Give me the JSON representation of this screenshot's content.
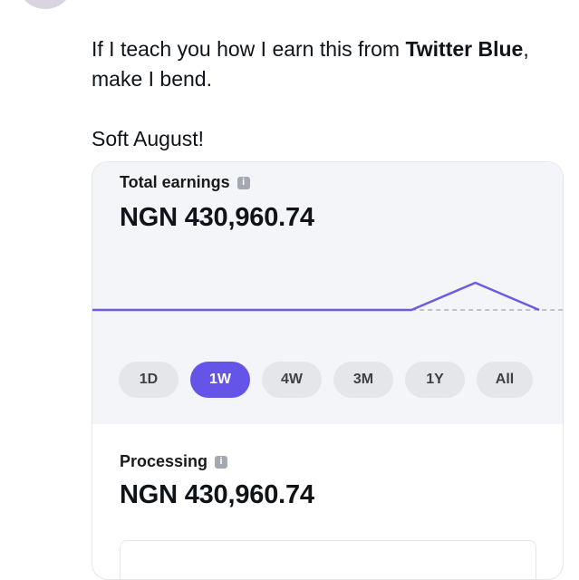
{
  "tweet": {
    "line1_prefix": "If I teach you how I earn this from ",
    "line1_bold": "Twitter Blue",
    "line1_suffix": ",",
    "line2": "make I bend.",
    "line3": "Soft August!"
  },
  "card": {
    "total_label": "Total earnings",
    "total_amount": "NGN 430,960.74",
    "processing_label": "Processing",
    "processing_amount": "NGN 430,960.74",
    "info_icon": "i",
    "periods": [
      {
        "label": "1D",
        "active": false
      },
      {
        "label": "1W",
        "active": true
      },
      {
        "label": "4W",
        "active": false
      },
      {
        "label": "3M",
        "active": false
      },
      {
        "label": "1Y",
        "active": false
      },
      {
        "label": "All",
        "active": false
      }
    ]
  },
  "colors": {
    "accent": "#6554e8",
    "chart_line": "#6a5ce0",
    "card_bg": "#f4f5f8"
  },
  "chart_data": {
    "type": "line",
    "x": [
      0,
      1,
      2,
      3,
      4,
      5,
      6,
      7
    ],
    "values": [
      0,
      0,
      0,
      0,
      0,
      0,
      1,
      0
    ],
    "baseline": "dashed",
    "grid": false
  }
}
